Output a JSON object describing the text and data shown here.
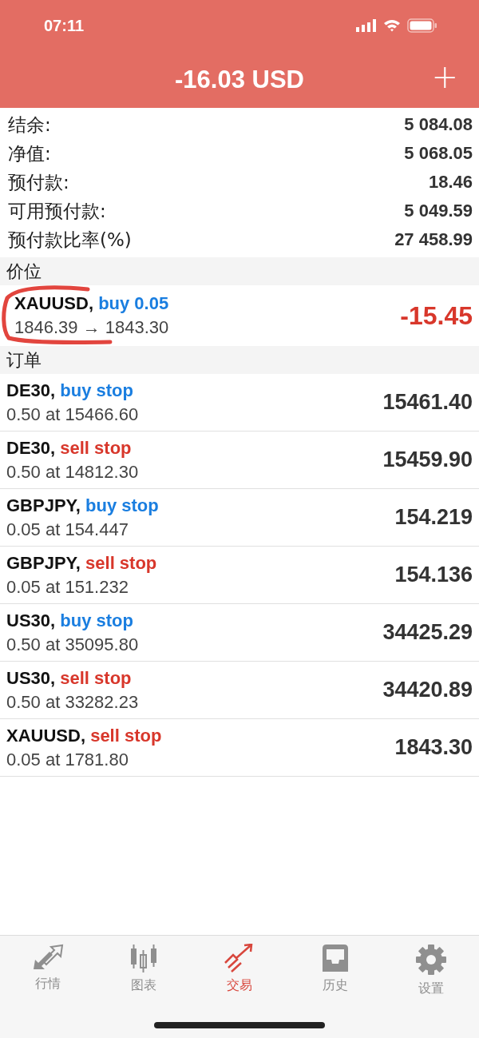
{
  "status_bar": {
    "time": "07:11"
  },
  "header": {
    "title": "-16.03 USD",
    "action": "+"
  },
  "summary": [
    {
      "label": "结余:",
      "value": "5 084.08"
    },
    {
      "label": "净值:",
      "value": "5 068.05"
    },
    {
      "label": "预付款:",
      "value": "18.46"
    },
    {
      "label": "可用预付款:",
      "value": "5 049.59"
    },
    {
      "label": "预付款比率(%)",
      "value": "27 458.99"
    }
  ],
  "positions_header": "价位",
  "positions": [
    {
      "symbol": "XAUUSD,",
      "color": "#1a7ee0",
      "action": "buy 0.05",
      "prices": "1846.39 → 1843.30",
      "profit": "-15.45",
      "loss": true
    }
  ],
  "orders_header": "订单",
  "orders": [
    {
      "symbol": "DE30,",
      "color": "#1a7ee0",
      "type": "buy stop",
      "detail": "0.50 at 15466.60",
      "price": "15461.40"
    },
    {
      "symbol": "DE30,",
      "color": "#d8372b",
      "type": "sell stop",
      "detail": "0.50 at 14812.30",
      "price": "15459.90"
    },
    {
      "symbol": "GBPJPY,",
      "color": "#1a7ee0",
      "type": "buy stop",
      "detail": "0.05 at 154.447",
      "price": "154.219"
    },
    {
      "symbol": "GBPJPY,",
      "color": "#d8372b",
      "type": "sell stop",
      "detail": "0.05 at 151.232",
      "price": "154.136"
    },
    {
      "symbol": "US30,",
      "color": "#1a7ee0",
      "type": "buy stop",
      "detail": "0.50 at 35095.80",
      "price": "34425.29"
    },
    {
      "symbol": "US30,",
      "color": "#d8372b",
      "type": "sell stop",
      "detail": "0.50 at 33282.23",
      "price": "34420.89"
    },
    {
      "symbol": "XAUUSD,",
      "color": "#d8372b",
      "type": "sell stop",
      "detail": "0.05 at 1781.80",
      "price": "1843.30"
    }
  ],
  "tab_bar": [
    {
      "kind": "quotes",
      "label": "行情",
      "selected": false
    },
    {
      "kind": "chart",
      "label": "图表",
      "selected": false
    },
    {
      "kind": "trade",
      "label": "交易",
      "selected": true
    },
    {
      "kind": "history",
      "label": "历史",
      "selected": false
    },
    {
      "kind": "settings",
      "label": "设置",
      "selected": false
    }
  ]
}
